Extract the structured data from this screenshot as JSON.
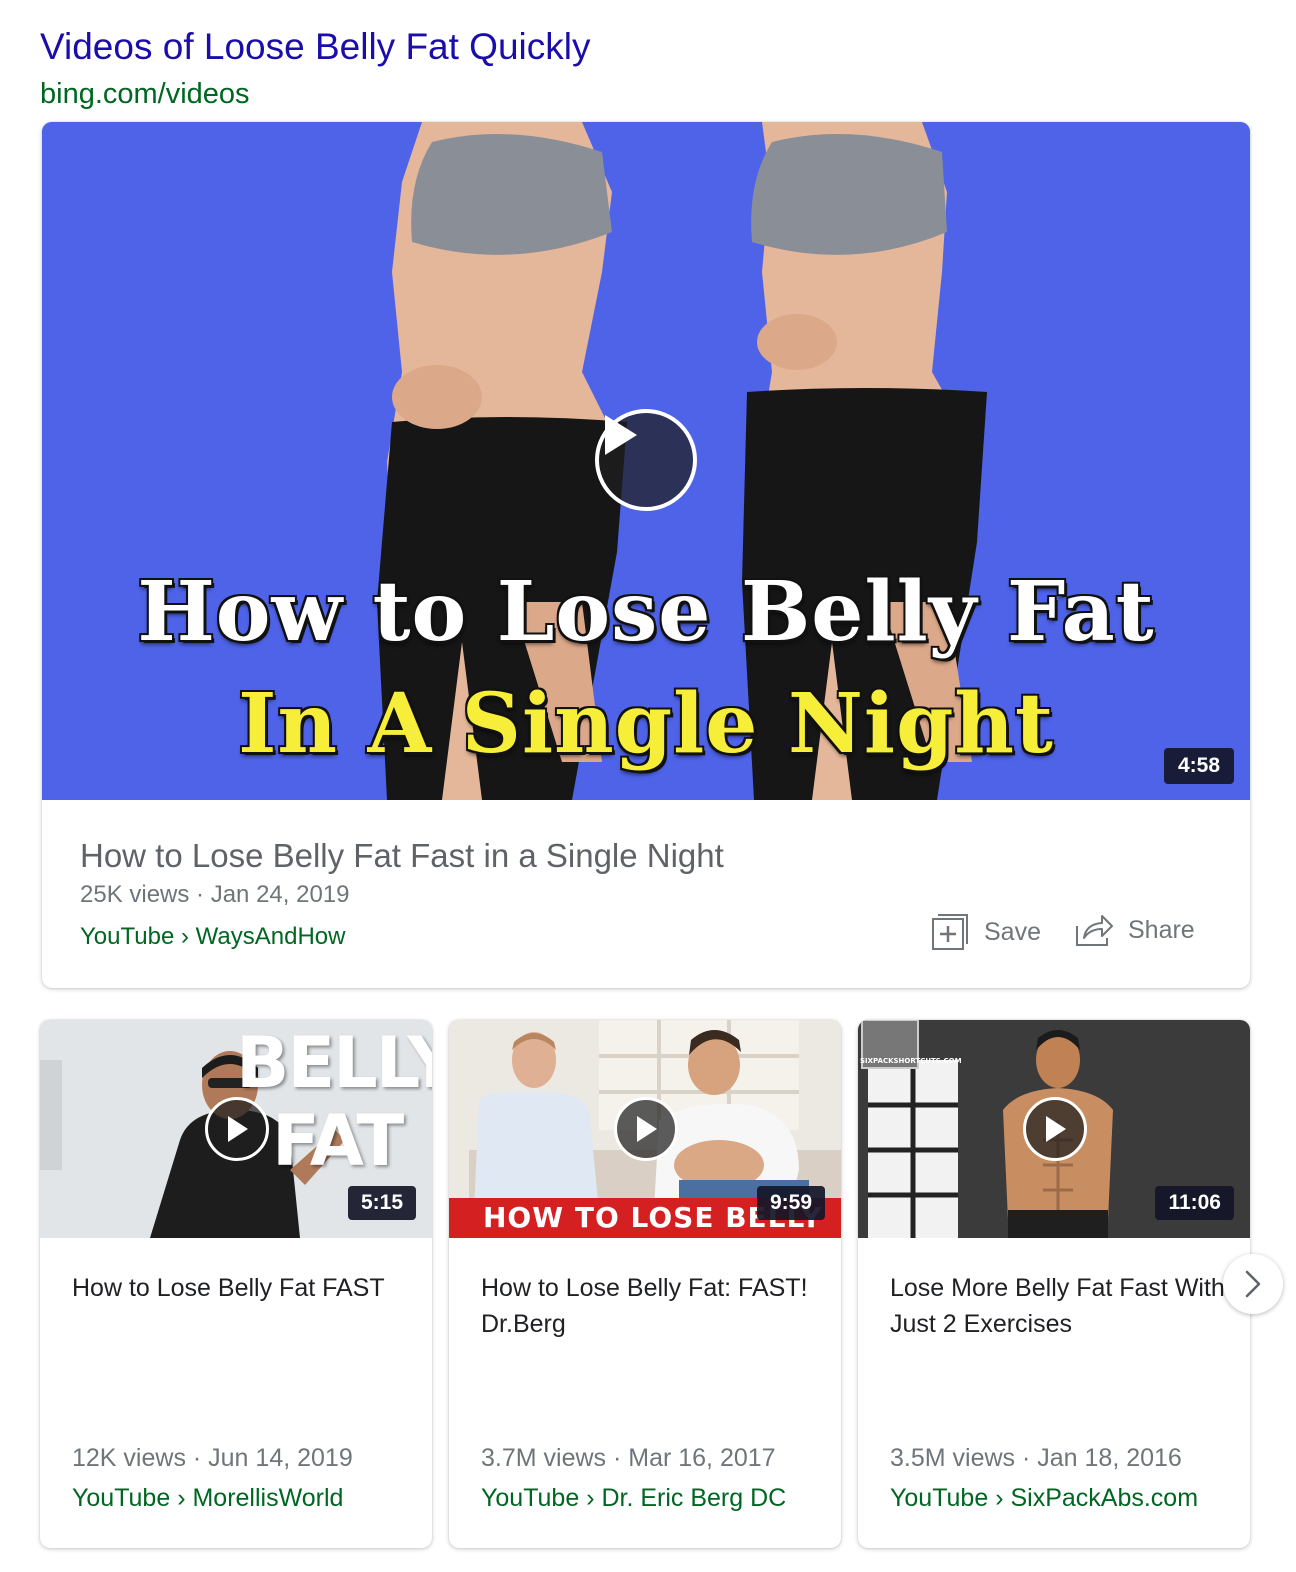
{
  "header": {
    "title": "Videos of Loose Belly Fat Quickly",
    "url": "bing.com/videos"
  },
  "featured": {
    "thumbnail_line1": "How to Lose Belly Fat",
    "thumbnail_line2": "In A Single Night",
    "duration": "4:58",
    "title": "How to Lose Belly Fat Fast in a Single Night",
    "meta": "25K views · Jan 24, 2019",
    "source": "YouTube › WaysAndHow",
    "save_label": "Save",
    "share_label": "Share"
  },
  "videos": [
    {
      "thumb_words": [
        "BELLY",
        "FAT"
      ],
      "duration": "5:15",
      "title": "How to Lose Belly Fat FAST",
      "meta": "12K views · Jun 14, 2019",
      "source": "YouTube › MorellisWorld"
    },
    {
      "thumb_banner": "HOW TO LOSE BELLY FAT",
      "duration": "9:59",
      "title": "How to Lose Belly Fat: FAST! Dr.Berg",
      "meta": "3.7M views · Mar 16, 2017",
      "source": "YouTube › Dr. Eric Berg DC"
    },
    {
      "thumb_logo": "SIXPACKSHORTCUTS.COM",
      "duration": "11:06",
      "title": "Lose More Belly Fat Fast With Just 2 Exercises",
      "meta": "3.5M views · Jan 18, 2016",
      "source": "YouTube › SixPackAbs.com"
    }
  ],
  "icons": {
    "play": "play-icon",
    "save": "plus-square-icon",
    "share": "share-arrow-icon",
    "next": "chevron-right-icon"
  },
  "colors": {
    "link_blue": "#1a0dab",
    "url_green": "#006621",
    "featured_bg": "#4e63e8",
    "thumb_yellow": "#f7ee3a",
    "banner_red": "#d42020"
  }
}
